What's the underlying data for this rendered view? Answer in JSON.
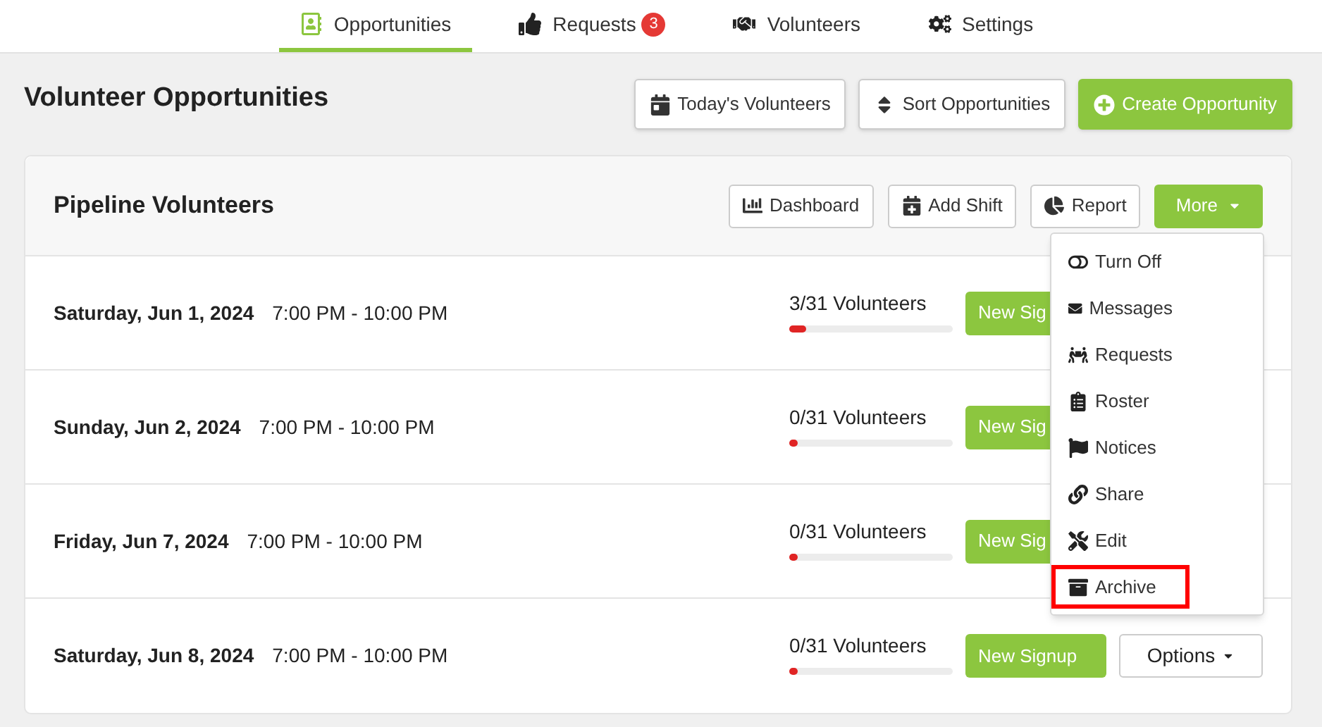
{
  "nav_tabs": [
    {
      "label": "Opportunities",
      "selected": true
    },
    {
      "label": "Requests",
      "selected": false,
      "badge": "3"
    },
    {
      "label": "Volunteers",
      "selected": false
    },
    {
      "label": "Settings",
      "selected": false
    }
  ],
  "page_title": "Volunteer Opportunities",
  "header_buttons": [
    {
      "label": "Today's Volunteers",
      "kind": "plain"
    },
    {
      "label": "Sort Opportunities",
      "kind": "plain"
    },
    {
      "label": "Create Opportunity",
      "kind": "primary"
    }
  ],
  "card": {
    "title": "Pipeline Volunteers",
    "buttons": [
      {
        "label": "Dashboard",
        "kind": "plain"
      },
      {
        "label": "Add Shift",
        "kind": "plain"
      },
      {
        "label": "Report",
        "kind": "plain"
      },
      {
        "label": "More",
        "kind": "primary"
      }
    ],
    "shifts": [
      {
        "date": "Saturday, Jun 1, 2024",
        "time": "7:00 PM - 10:00 PM",
        "count": "3/31 Volunteers",
        "level": 0.1,
        "signup": "New Sig"
      },
      {
        "date": "Sunday, Jun 2, 2024",
        "time": "7:00 PM - 10:00 PM",
        "count": "0/31 Volunteers",
        "level": 0,
        "signup": "New Sig"
      },
      {
        "date": "Friday, Jun 7, 2024",
        "time": "7:00 PM - 10:00 PM",
        "count": "0/31 Volunteers",
        "level": 0,
        "signup": "New Sig"
      },
      {
        "date": "Saturday, Jun 8, 2024",
        "time": "7:00 PM - 10:00 PM",
        "count": "0/31 Volunteers",
        "level": 0,
        "signup": "New Signup",
        "options": "Options"
      }
    ]
  },
  "more_menu": [
    {
      "label": "Turn Off",
      "highlighted": false
    },
    {
      "label": "Messages",
      "highlighted": false
    },
    {
      "label": "Requests",
      "highlighted": false
    },
    {
      "label": "Roster",
      "highlighted": false
    },
    {
      "label": "Notices",
      "highlighted": false
    },
    {
      "label": "Share",
      "highlighted": false
    },
    {
      "label": "Edit",
      "highlighted": false
    },
    {
      "label": "Archive",
      "highlighted": true
    }
  ]
}
